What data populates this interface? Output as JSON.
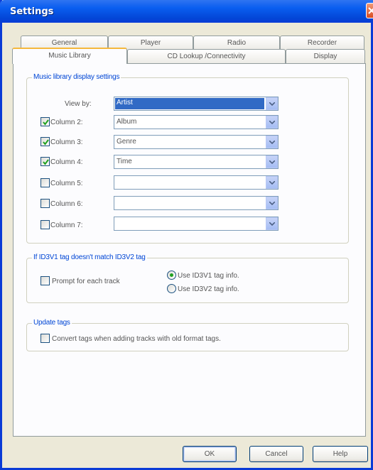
{
  "window": {
    "title": "Settings"
  },
  "tabs": {
    "row1": [
      {
        "label": "General"
      },
      {
        "label": "Player"
      },
      {
        "label": "Radio"
      },
      {
        "label": "Recorder"
      }
    ],
    "row2": [
      {
        "label": "Music Library",
        "active": true
      },
      {
        "label": "CD Lookup /Connectivity"
      },
      {
        "label": "Display"
      }
    ]
  },
  "library_group": {
    "legend": "Music library display settings",
    "view_by": {
      "label": "View by:",
      "value": "Artist"
    },
    "columns": [
      {
        "label": "Column 2:",
        "checked": true,
        "value": "Album"
      },
      {
        "label": "Column 3:",
        "checked": true,
        "value": "Genre"
      },
      {
        "label": "Column 4:",
        "checked": true,
        "value": "Time"
      },
      {
        "label": "Column 5:",
        "checked": false,
        "value": ""
      },
      {
        "label": "Column 6:",
        "checked": false,
        "value": ""
      },
      {
        "label": "Column 7:",
        "checked": false,
        "value": ""
      }
    ]
  },
  "id3_group": {
    "legend": "If ID3V1 tag doesn't match ID3V2 tag",
    "prompt": {
      "label": "Prompt for each track",
      "checked": false
    },
    "use_v1": {
      "label": "Use ID3V1 tag info.",
      "selected": true
    },
    "use_v2": {
      "label": "Use ID3V2 tag info.",
      "selected": false
    }
  },
  "update_group": {
    "legend": "Update tags",
    "convert": {
      "label": "Convert tags when adding tracks with old format tags.",
      "checked": false
    }
  },
  "buttons": {
    "ok": "OK",
    "cancel": "Cancel",
    "help": "Help"
  },
  "colors": {
    "titlebar": "#0a5ef0",
    "legend_text": "#0046d5",
    "selection": "#316ac5",
    "check_mark": "#21a121"
  }
}
